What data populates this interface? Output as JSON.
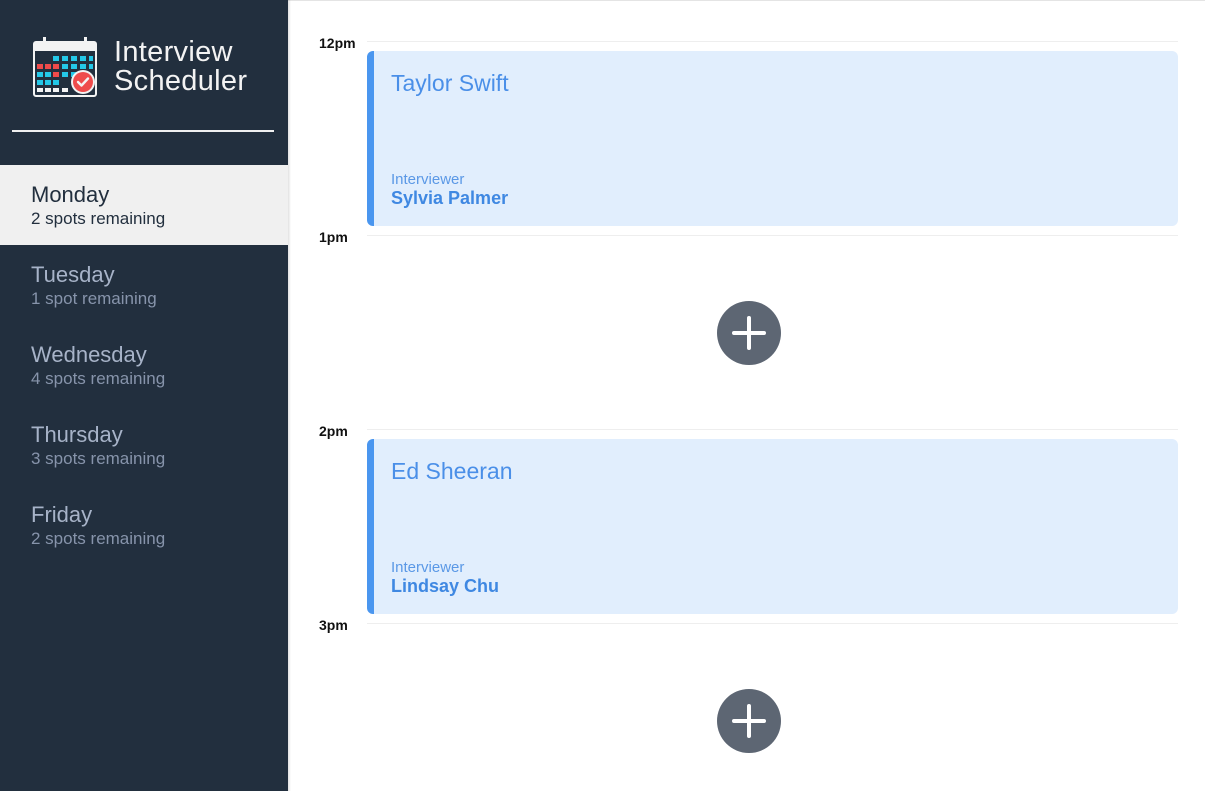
{
  "brand": {
    "title_line1": "Interview",
    "title_line2": "Scheduler",
    "icon": "calendar-check-icon"
  },
  "days": [
    {
      "name": "Monday",
      "spots": "2 spots remaining",
      "selected": true
    },
    {
      "name": "Tuesday",
      "spots": "1 spot remaining",
      "selected": false
    },
    {
      "name": "Wednesday",
      "spots": "4 spots remaining",
      "selected": false
    },
    {
      "name": "Thursday",
      "spots": "3 spots remaining",
      "selected": false
    },
    {
      "name": "Friday",
      "spots": "2 spots remaining",
      "selected": false
    }
  ],
  "schedule": {
    "times": [
      "12pm",
      "1pm",
      "2pm",
      "3pm"
    ],
    "appointments": [
      {
        "student": "Taylor Swift",
        "interviewer_label": "Interviewer",
        "interviewer": "Sylvia Palmer"
      },
      {
        "student": "Ed Sheeran",
        "interviewer_label": "Interviewer",
        "interviewer": "Lindsay Chu"
      }
    ],
    "add_icon": "plus-icon"
  },
  "colors": {
    "sidebar": "#222f3e",
    "selected_day": "#f0f0f0",
    "appointment_bg": "#e1eefd",
    "appointment_accent": "#4a96ef",
    "add_button": "#5d6673"
  }
}
